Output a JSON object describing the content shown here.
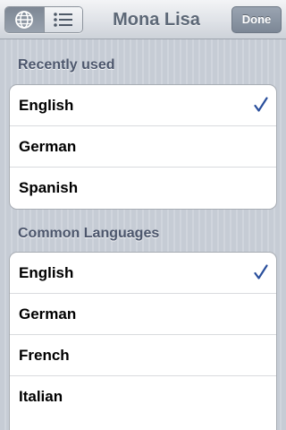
{
  "navbar": {
    "title": "Mona Lisa",
    "done_label": "Done",
    "segments": [
      {
        "icon": "globe-icon",
        "selected": true
      },
      {
        "icon": "list-icon",
        "selected": false
      }
    ]
  },
  "sections": [
    {
      "header": "Recently used",
      "items": [
        {
          "label": "English",
          "checked": true
        },
        {
          "label": "German",
          "checked": false
        },
        {
          "label": "Spanish",
          "checked": false
        }
      ]
    },
    {
      "header": "Common Languages",
      "items": [
        {
          "label": "English",
          "checked": true
        },
        {
          "label": "German",
          "checked": false
        },
        {
          "label": "French",
          "checked": false
        },
        {
          "label": "Italian",
          "checked": false
        }
      ]
    }
  ],
  "colors": {
    "accent": "#2a4f9c",
    "header_text": "#4c566c",
    "title_text": "#5d6877"
  }
}
